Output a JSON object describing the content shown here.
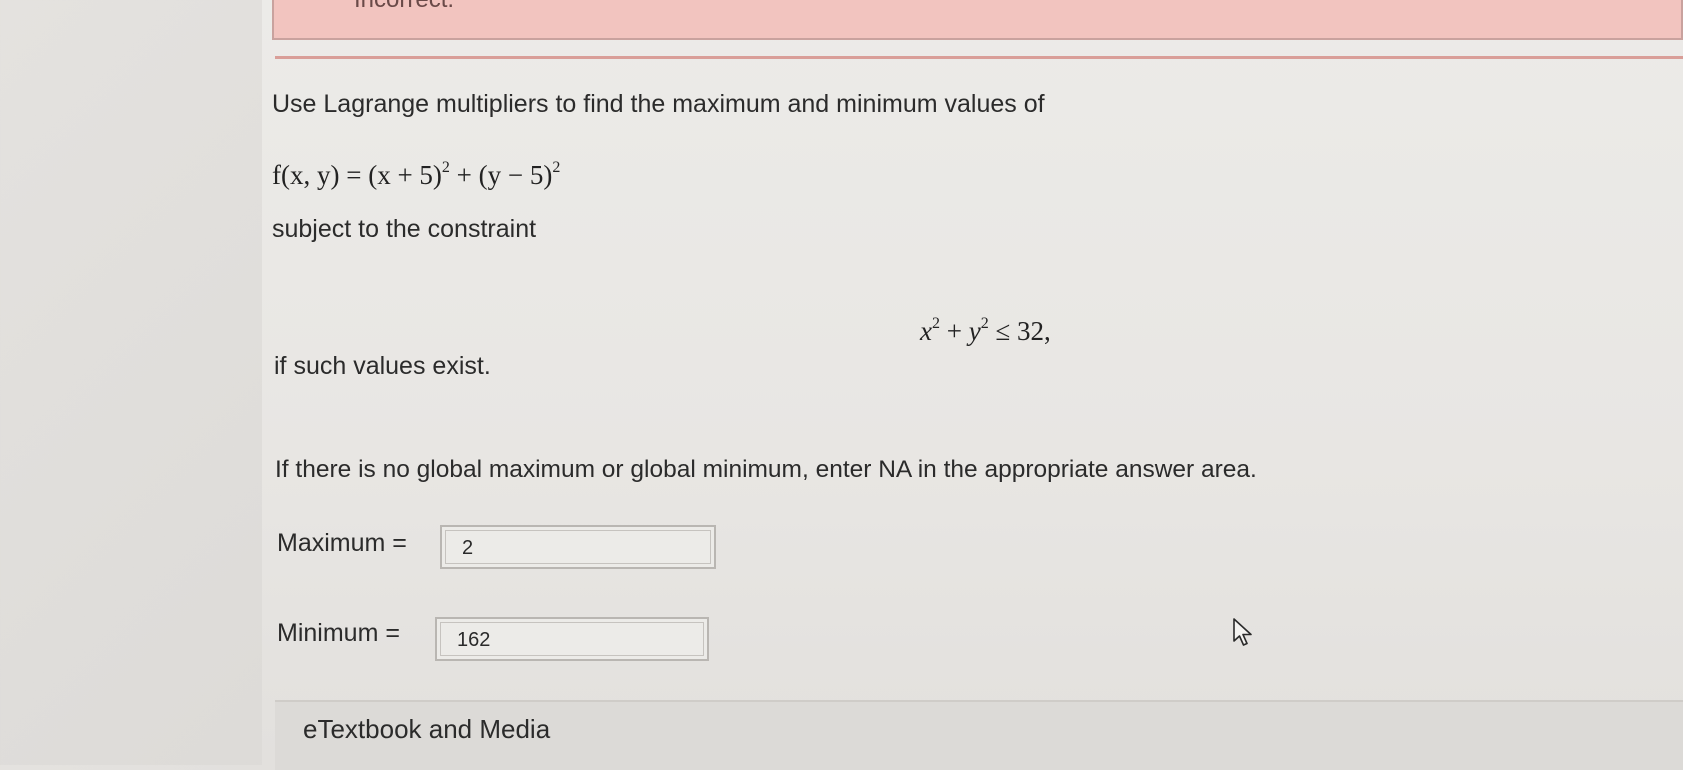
{
  "feedback": {
    "status": "Incorrect."
  },
  "question": {
    "intro": "Use Lagrange multipliers to find the maximum and minimum values of",
    "function_lhs": "f(x, y) = (x + 5)",
    "function_mid": " + (y − 5)",
    "exponent": "2",
    "constraint_intro": "subject to the constraint",
    "constraint_x": "x",
    "constraint_plus": " + ",
    "constraint_y": "y",
    "constraint_rhs": " ≤ 32,",
    "condition": "if such values exist.",
    "instruction": "If there is no global maximum or global minimum, enter NA in the appropriate answer area."
  },
  "answers": {
    "maximum_label": "Maximum  =",
    "maximum_value": "2",
    "minimum_label": "Minimum  =",
    "minimum_value": "162"
  },
  "resources": {
    "etextbook_label": "eTextbook and Media"
  },
  "icons": {
    "cursor": "mouse-pointer-icon"
  }
}
